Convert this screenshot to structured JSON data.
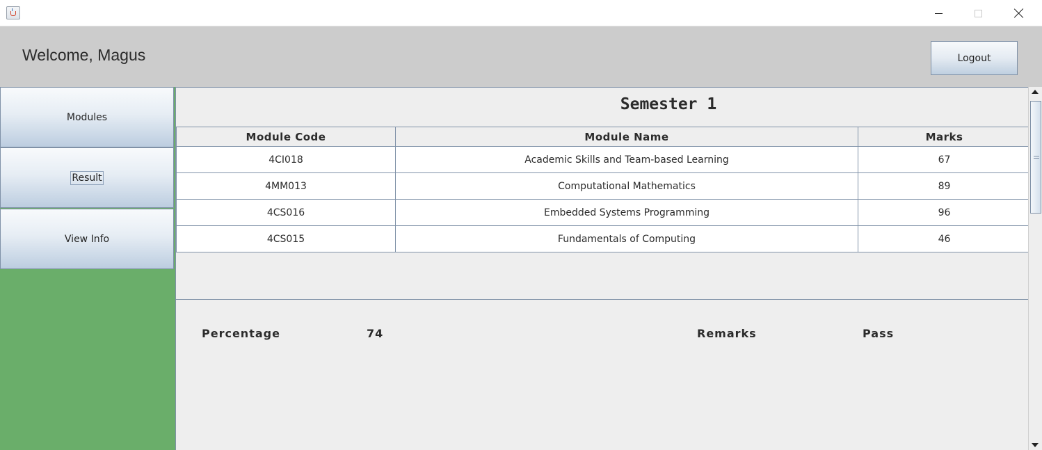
{
  "window": {
    "icon": "java-cup-icon",
    "controls": {
      "minimize": "minimize-icon",
      "maximize": "maximize-icon",
      "close": "close-icon"
    }
  },
  "header": {
    "welcome": "Welcome, Magus",
    "logout_label": "Logout"
  },
  "sidebar": {
    "items": [
      {
        "label": "Modules"
      },
      {
        "label": "Result"
      },
      {
        "label": "View Info"
      }
    ]
  },
  "main": {
    "title": "Semester 1",
    "table": {
      "columns": [
        "Module Code",
        "Module Name",
        "Marks"
      ],
      "rows": [
        [
          "4CI018",
          "Academic Skills and Team-based Learning",
          "67"
        ],
        [
          "4MM013",
          "Computational Mathematics",
          "89"
        ],
        [
          "4CS016",
          "Embedded Systems Programming",
          "96"
        ],
        [
          "4CS015",
          "Fundamentals of Computing",
          "46"
        ]
      ]
    },
    "summary": {
      "percentage_label": "Percentage",
      "percentage_value": "74",
      "remarks_label": "Remarks",
      "remarks_value": "Pass"
    }
  },
  "colors": {
    "header_bg": "#cccccc",
    "sidebar_bg": "#6aae6a",
    "content_bg": "#eeeeee",
    "border": "#7f91a7"
  }
}
